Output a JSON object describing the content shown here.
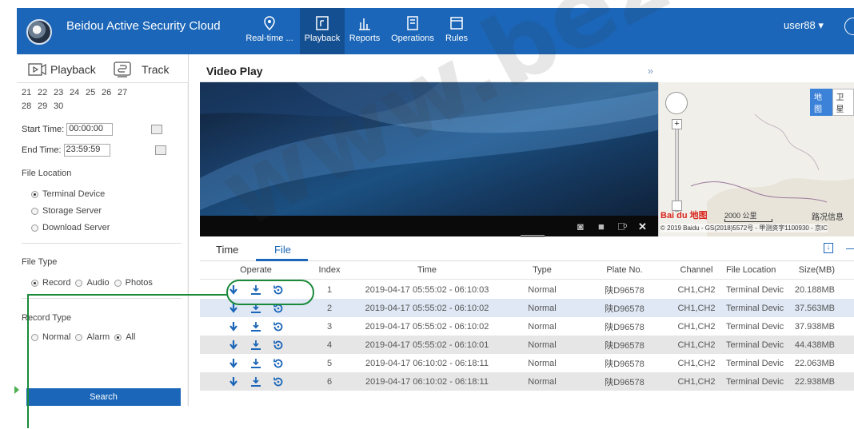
{
  "app": {
    "title": "Beidou Active Security Cloud",
    "brand_color": "#1b66b8",
    "user": "user88 ▾"
  },
  "nav": [
    {
      "label": "Real-time ...",
      "icon": "location-pin-icon",
      "active": false
    },
    {
      "label": "Playback",
      "icon": "playback-icon",
      "active": true
    },
    {
      "label": "Reports",
      "icon": "bar-chart-icon",
      "active": false
    },
    {
      "label": "Operations",
      "icon": "operations-icon",
      "active": false
    },
    {
      "label": "Rules",
      "icon": "rules-icon",
      "active": false
    }
  ],
  "sidebar": {
    "tabs": [
      {
        "label": "Playback",
        "icon": "video-playback-icon"
      },
      {
        "label": "Track",
        "icon": "track-icon"
      }
    ],
    "calendar": [
      [
        "21",
        "22",
        "23",
        "24",
        "25",
        "26",
        "27"
      ],
      [
        "28",
        "29",
        "30"
      ]
    ],
    "start_time_label": "Start Time:",
    "start_time_value": "00:00:00",
    "end_time_label": "End Time:",
    "end_time_value": "23:59:59",
    "file_location_label": "File Location",
    "file_location_options": [
      "Terminal Device",
      "Storage Server",
      "Download Server"
    ],
    "file_location_selected": "Terminal Device",
    "file_type_label": "File Type",
    "file_type_options": [
      "Record",
      "Audio",
      "Photos"
    ],
    "file_type_selected": "Record",
    "record_type_label": "Record Type",
    "record_type_options": [
      "Normal",
      "Alarm",
      "All"
    ],
    "record_type_selected": "All",
    "search_label": "Search"
  },
  "video": {
    "title": "Video Play",
    "collapse": "»",
    "controls": [
      "camera-icon",
      "stop-icon",
      "volume-icon",
      "fullscreen-icon"
    ]
  },
  "map": {
    "types": [
      "地图",
      "卫星"
    ],
    "selected_type": "地图",
    "scale": "2000 公里",
    "traffic": "路况信息",
    "logo": "Bai du 地图",
    "copyright": "© 2019 Baidu - GS(2018)5572号 - 甲测资字1100930 - 京IC"
  },
  "tabs": [
    {
      "label": "Time",
      "active": false
    },
    {
      "label": "File",
      "active": true
    }
  ],
  "tabs_extra": "—",
  "table": {
    "headers": [
      "Operate",
      "Index",
      "Time",
      "Type",
      "Plate No.",
      "Channel",
      "File Location",
      "Size(MB)"
    ],
    "rows": [
      {
        "index": "1",
        "time": "2019-04-17 05:55:02 - 06:10:03",
        "type": "Normal",
        "plate": "陕D96578",
        "channel": "CH1,CH2",
        "location": "Terminal Devic",
        "size": "20.188MB"
      },
      {
        "index": "2",
        "time": "2019-04-17 05:55:02 - 06:10:02",
        "type": "Normal",
        "plate": "陕D96578",
        "channel": "CH1,CH2",
        "location": "Terminal Devic",
        "size": "37.563MB"
      },
      {
        "index": "3",
        "time": "2019-04-17 05:55:02 - 06:10:02",
        "type": "Normal",
        "plate": "陕D96578",
        "channel": "CH1,CH2",
        "location": "Terminal Devic",
        "size": "37.938MB"
      },
      {
        "index": "4",
        "time": "2019-04-17 05:55:02 - 06:10:01",
        "type": "Normal",
        "plate": "陕D96578",
        "channel": "CH1,CH2",
        "location": "Terminal Devic",
        "size": "44.438MB"
      },
      {
        "index": "5",
        "time": "2019-04-17 06:10:02 - 06:18:11",
        "type": "Normal",
        "plate": "陕D96578",
        "channel": "CH1,CH2",
        "location": "Terminal Devic",
        "size": "22.063MB"
      },
      {
        "index": "6",
        "time": "2019-04-17 06:10:02 - 06:18:11",
        "type": "Normal",
        "plate": "陕D96578",
        "channel": "CH1,CH2",
        "location": "Terminal Devic",
        "size": "22.938MB"
      }
    ],
    "operate_icons": [
      "download-arrow-icon",
      "download-tray-icon",
      "replay-icon"
    ]
  },
  "annotation": {
    "color": "#1a8a3a"
  },
  "watermark": "www.bez"
}
